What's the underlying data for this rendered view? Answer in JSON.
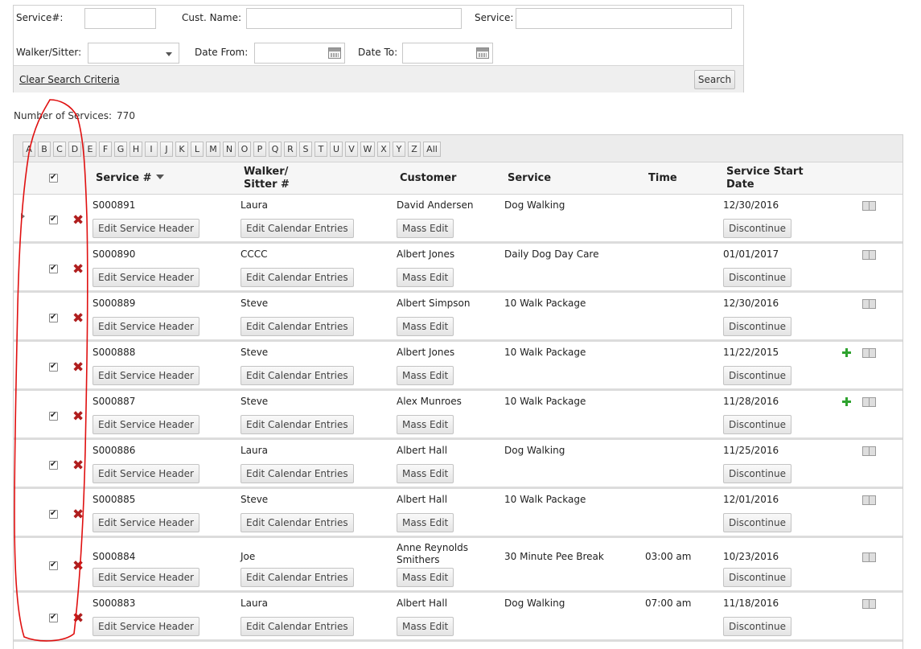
{
  "search": {
    "service_no_label": "Service#:",
    "service_no_value": "",
    "cust_name_label": "Cust. Name:",
    "cust_name_value": "",
    "service_label": "Service:",
    "service_value": "",
    "walker_label": "Walker/Sitter:",
    "walker_value": "",
    "date_from_label": "Date From:",
    "date_from_value": "",
    "date_to_label": "Date To:",
    "date_to_value": "",
    "clear_label": "Clear Search Criteria",
    "search_button": "Search"
  },
  "count": {
    "label": "Number of Services:",
    "value": "770"
  },
  "alphabet": [
    "A",
    "B",
    "C",
    "D",
    "E",
    "F",
    "G",
    "H",
    "I",
    "J",
    "K",
    "L",
    "M",
    "N",
    "O",
    "P",
    "Q",
    "R",
    "S",
    "T",
    "U",
    "V",
    "W",
    "X",
    "Y",
    "Z",
    "All"
  ],
  "columns": {
    "service_no": "Service #",
    "walker_line1": "Walker/",
    "walker_line2": "Sitter #",
    "customer": "Customer",
    "service": "Service",
    "time": "Time",
    "start_line1": "Service Start",
    "start_line2": "Date"
  },
  "buttons": {
    "edit_header": "Edit Service Header",
    "edit_calendar": "Edit Calendar Entries",
    "mass_edit": "Mass Edit",
    "discontinue": "Discontinue"
  },
  "rows": [
    {
      "id": "S000891",
      "walker": "Laura",
      "customer": "David Andersen",
      "service": "Dog Walking",
      "time": "",
      "start": "12/30/2016",
      "plus": false
    },
    {
      "id": "S000890",
      "walker": "CCCC",
      "customer": "Albert Jones",
      "service": "Daily Dog Day Care",
      "time": "",
      "start": "01/01/2017",
      "plus": false
    },
    {
      "id": "S000889",
      "walker": "Steve",
      "customer": "Albert Simpson",
      "service": "10 Walk Package",
      "time": "",
      "start": "12/30/2016",
      "plus": false
    },
    {
      "id": "S000888",
      "walker": "Steve",
      "customer": "Albert Jones",
      "service": "10 Walk Package",
      "time": "",
      "start": "11/22/2015",
      "plus": true
    },
    {
      "id": "S000887",
      "walker": "Steve",
      "customer": "Alex Munroes",
      "service": "10 Walk Package",
      "time": "",
      "start": "11/28/2016",
      "plus": true
    },
    {
      "id": "S000886",
      "walker": "Laura",
      "customer": "Albert Hall",
      "service": "Dog Walking",
      "time": "",
      "start": "11/25/2016",
      "plus": false
    },
    {
      "id": "S000885",
      "walker": "Steve",
      "customer": "Albert Hall",
      "service": "10 Walk Package",
      "time": "",
      "start": "12/01/2016",
      "plus": false
    },
    {
      "id": "S000884",
      "walker": "Joe",
      "customer": "Anne Reynolds Smithers",
      "service": "30 Minute Pee Break",
      "time": "03:00 am",
      "start": "10/23/2016",
      "plus": false
    },
    {
      "id": "S000883",
      "walker": "Laura",
      "customer": "Albert Hall",
      "service": "Dog Walking",
      "time": "07:00 am",
      "start": "11/18/2016",
      "plus": false
    }
  ],
  "colors": {
    "delete_icon": "#b01e1e",
    "add_icon": "#2ea22e",
    "annotation": "#e01010"
  }
}
